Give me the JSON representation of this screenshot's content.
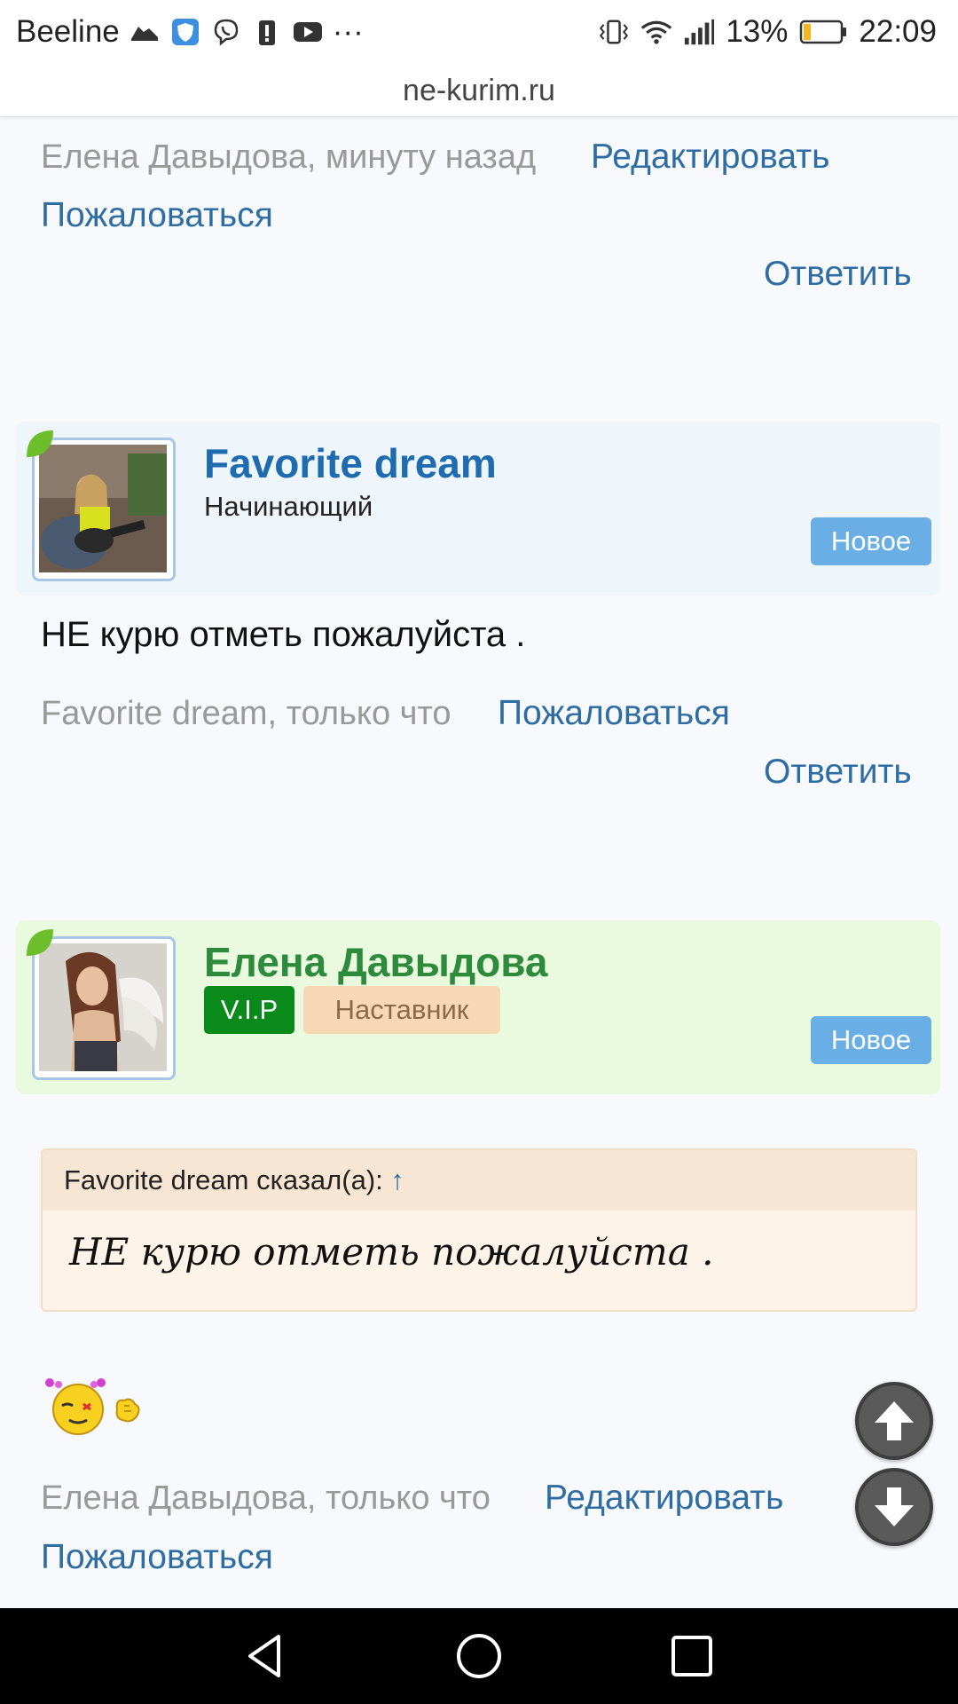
{
  "status_bar": {
    "carrier": "Beeline",
    "more_icon": "···",
    "battery_percent": "13%",
    "time": "22:09"
  },
  "browser": {
    "url": "ne-kurim.ru"
  },
  "top_post": {
    "meta": "Елена Давыдова, минуту назад",
    "edit": "Редактировать",
    "report": "Пожаловаться",
    "reply": "Ответить"
  },
  "post_favorite": {
    "author": "Favorite dream",
    "rank": "Начинающий",
    "badge": "Новое",
    "text": "НЕ курю отметь пожалуйста .",
    "meta": "Favorite dream, только что",
    "report": "Пожаловаться",
    "reply": "Ответить"
  },
  "post_elena": {
    "author": "Елена Давыдова",
    "vip": "V.I.P",
    "rank": "Наставник",
    "badge": "Новое",
    "quote_header": "Favorite dream сказал(а):",
    "quote_arrow": "↑",
    "quote_text": "НЕ курю отметь пожалуйста .",
    "meta": "Елена Давыдова, только что",
    "edit": "Редактировать",
    "report": "Пожаловаться"
  },
  "colors": {
    "link": "#2e6da4",
    "favorite_name": "#1e6bb0",
    "elena_name": "#2e8b3e",
    "badge_new": "#6aaee6",
    "badge_vip": "#0a8a1a",
    "badge_mentor": "#f6d8b6"
  },
  "icons": [
    "shoe-icon",
    "shield-icon",
    "viber-icon",
    "alert-icon",
    "youtube-icon",
    "vibrate-icon",
    "wifi-icon",
    "signal-icon",
    "battery-icon",
    "leaf-icon",
    "smiley-icon",
    "scroll-up-icon",
    "scroll-down-icon",
    "back-icon",
    "home-icon",
    "recents-icon"
  ]
}
